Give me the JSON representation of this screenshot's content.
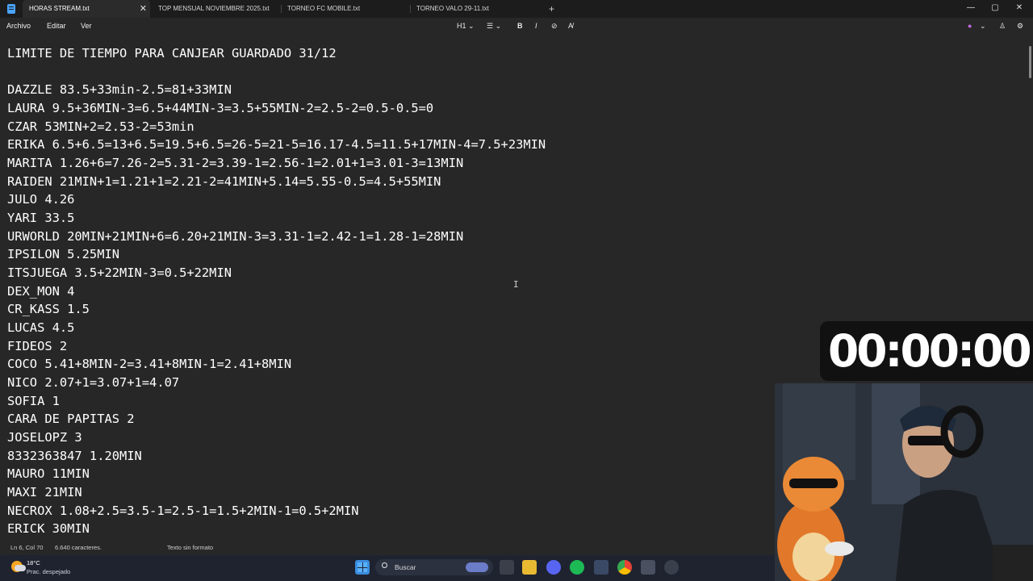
{
  "window": {
    "tabs": [
      {
        "label": "HORAS STREAM.txt",
        "active": true
      },
      {
        "label": "TOP MENSUAL NOVIEMBRE 2025.txt",
        "active": false
      },
      {
        "label": "TORNEO FC MOBILE.txt",
        "active": false
      },
      {
        "label": "TORNEO VALO 29-11.txt",
        "active": false
      }
    ],
    "new_tab": "+",
    "tab_close": "✕",
    "controls": {
      "minimize": "—",
      "maximize": "▢",
      "close": "✕"
    }
  },
  "menu": {
    "items": [
      "Archivo",
      "Editar",
      "Ver"
    ],
    "toolbar": {
      "heading": "H1 ⌄",
      "list": "☰ ⌄",
      "bold": "B",
      "italic": "I",
      "link": "⊘",
      "clear_format": "A̸"
    },
    "right_icons": {
      "copilot": "●",
      "account": "⌄",
      "user": "♙",
      "settings": "⚙"
    }
  },
  "editor": {
    "lines": [
      "LIMITE DE TIEMPO PARA CANJEAR GUARDADO 31/12",
      "",
      "DAZZLE 83.5+33min-2.5=81+33MIN",
      "LAURA 9.5+36MIN-3=6.5+44MIN-3=3.5+55MIN-2=2.5-2=0.5-0.5=0",
      "CZAR 53MIN+2=2.53-2=53min",
      "ERIKA 6.5+6.5=13+6.5=19.5+6.5=26-5=21-5=16.17-4.5=11.5+17MIN-4=7.5+23MIN",
      "MARITA 1.26+6=7.26-2=5.31-2=3.39-1=2.56-1=2.01+1=3.01-3=13MIN",
      "RAIDEN 21MIN+1=1.21+1=2.21-2=41MIN+5.14=5.55-0.5=4.5+55MIN",
      "JULO 4.26",
      "YARI 33.5",
      "URWORLD 20MIN+21MIN+6=6.20+21MIN-3=3.31-1=2.42-1=1.28-1=28MIN",
      "IPSILON 5.25MIN",
      "ITSJUEGA 3.5+22MIN-3=0.5+22MIN",
      "DEX_MON 4",
      "CR_KASS 1.5",
      "LUCAS 4.5",
      "FIDEOS 2",
      "COCO 5.41+8MIN-2=3.41+8MIN-1=2.41+8MIN",
      "NICO 2.07+1=3.07+1=4.07",
      "SOFIA 1",
      "CARA DE PAPITAS 2",
      "JOSELOPZ 3",
      "8332363847 1.20MIN",
      "MAURO 11MIN",
      "MAXI 21MIN",
      "NECROX 1.08+2.5=3.5-1=2.5-1=1.5+2MIN-1=0.5+2MIN",
      "ERICK 30MIN"
    ],
    "cursor_glyph": "I"
  },
  "status": {
    "position": "Ln 6, Col 70",
    "chars": "6.640 caracteres.",
    "format": "Texto sin formato"
  },
  "taskbar": {
    "temperature": "18°C",
    "weather": "Prac. despejado",
    "search_placeholder": "Buscar"
  },
  "overlay": {
    "timer": "00:00:00"
  }
}
